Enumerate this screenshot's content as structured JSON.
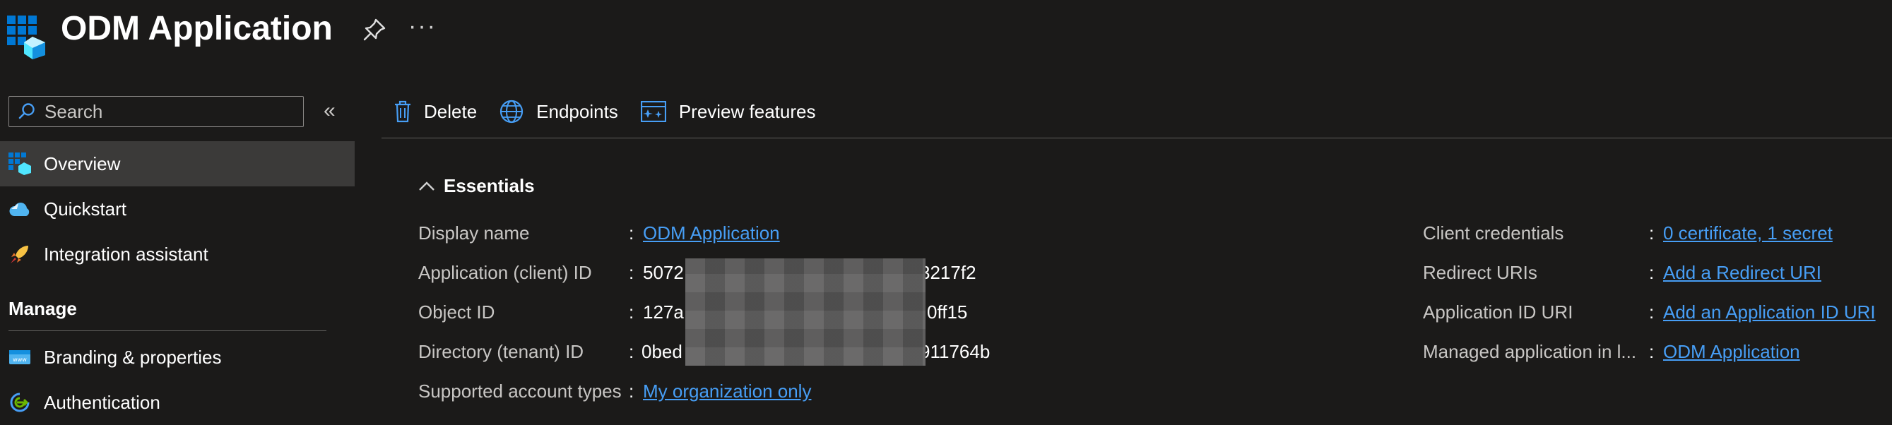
{
  "header": {
    "title": "ODM Application",
    "more_label": "···"
  },
  "sidebar": {
    "search_placeholder": "Search",
    "collapse_label": "«",
    "items": [
      {
        "label": "Overview",
        "icon": "app-grid-icon",
        "active": true
      },
      {
        "label": "Quickstart",
        "icon": "cloud-quickstart-icon",
        "active": false
      },
      {
        "label": "Integration assistant",
        "icon": "rocket-icon",
        "active": false
      }
    ],
    "manage_label": "Manage",
    "manage_items": [
      {
        "label": "Branding & properties",
        "icon": "branding-icon"
      },
      {
        "label": "Authentication",
        "icon": "authentication-icon"
      }
    ]
  },
  "toolbar": {
    "delete_label": "Delete",
    "endpoints_label": "Endpoints",
    "preview_label": "Preview features"
  },
  "essentials": {
    "heading": "Essentials",
    "left": [
      {
        "label": "Display name",
        "value": "ODM Application",
        "link": true
      },
      {
        "label": "Application (client) ID",
        "value_start": "5072",
        "value_end": "3217f2",
        "link": false
      },
      {
        "label": "Object ID",
        "value_start": "127a",
        "value_end": "0ff15",
        "link": false
      },
      {
        "label": "Directory (tenant) ID",
        "value_start": "0bed",
        "value_end": "911764b",
        "link": false
      },
      {
        "label": "Supported account types",
        "value": "My organization only",
        "link": true
      }
    ],
    "right": [
      {
        "label": "Client credentials",
        "value": "0 certificate, 1 secret"
      },
      {
        "label": "Redirect URIs",
        "value": "Add a Redirect URI"
      },
      {
        "label": "Application ID URI",
        "value": "Add an Application ID URI"
      },
      {
        "label": "Managed application in l...",
        "value": "ODM Application"
      }
    ],
    "colon": ":"
  },
  "colors": {
    "background": "#1b1a19",
    "link": "#479ef5",
    "active_nav": "#3b3a39",
    "accent": "#0078d4"
  }
}
